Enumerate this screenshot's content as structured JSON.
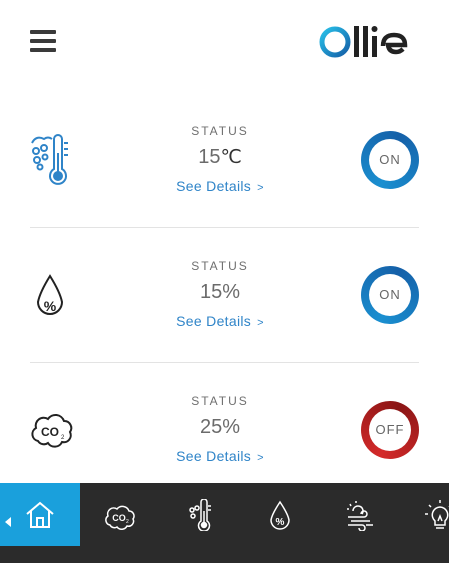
{
  "header": {
    "menu_icon": "hamburger-menu-icon",
    "logo_text": "Ollie",
    "logo_colors": {
      "o_ring": "#1a8fd0",
      "text": "#222222"
    }
  },
  "cards": [
    {
      "icon": "thermometer-icon",
      "status_label": "STATUS",
      "value": "15",
      "unit": "℃",
      "details_label": "See Details",
      "chevron": ">",
      "toggle": "ON"
    },
    {
      "icon": "humidity-drop-icon",
      "status_label": "STATUS",
      "value": "15%",
      "unit": "",
      "details_label": "See Details",
      "chevron": ">",
      "toggle": "ON"
    },
    {
      "icon": "co2-cloud-icon",
      "status_label": "STATUS",
      "value": "25%",
      "unit": "",
      "details_label": "See Details",
      "chevron": ">",
      "toggle": "OFF"
    }
  ],
  "toggle_colors": {
    "on": "#1a8fd0",
    "on_dark": "#1560a8",
    "off": "#d42a2a",
    "off_dark": "#8a1515"
  },
  "bottom_nav": {
    "active_color": "#1aa0dc",
    "background": "#2b2b2b",
    "items": [
      {
        "icon": "home-icon",
        "active": true
      },
      {
        "icon": "co2-cloud-icon",
        "active": false
      },
      {
        "icon": "thermometer-icon",
        "active": false
      },
      {
        "icon": "humidity-drop-icon",
        "active": false
      },
      {
        "icon": "weather-wind-icon",
        "active": false
      },
      {
        "icon": "light-bulb-icon",
        "active": false
      }
    ]
  }
}
